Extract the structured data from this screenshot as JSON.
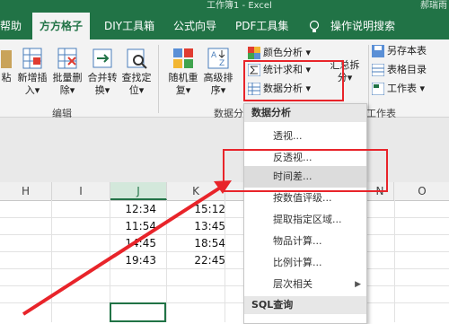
{
  "window": {
    "title": "工作簿1 - Excel",
    "account": "郝瑞雨"
  },
  "tabs": [
    "帮助",
    "方方格子",
    "DIY工具箱",
    "公式向导",
    "PDF工具集",
    "操作说明搜索"
  ],
  "ribbon": {
    "buttons": [
      {
        "label1": "粘",
        "label2": ""
      },
      {
        "label1": "新增插",
        "label2": "入▾"
      },
      {
        "label1": "批量删",
        "label2": "除▾"
      },
      {
        "label1": "合并转",
        "label2": "换▾"
      },
      {
        "label1": "查找定",
        "label2": "位▾"
      },
      {
        "label1": "随机重",
        "label2": "复▾"
      },
      {
        "label1": "高级排",
        "label2": "序▾"
      }
    ],
    "small_buttons": [
      "颜色分析 ▾",
      "统计求和 ▾",
      "数据分析 ▾"
    ],
    "right_buttons": [
      "另存本表",
      "表格目录",
      "工作表 ▾"
    ],
    "summary_split": {
      "label1": "汇总拆",
      "label2": "分▾"
    },
    "groups": [
      "编辑",
      "数据分",
      "工作表"
    ]
  },
  "sheet": {
    "columns": [
      "H",
      "I",
      "J",
      "K",
      "N",
      "O"
    ],
    "col_j": [
      "12:34",
      "11:54",
      "14:45",
      "19:43"
    ],
    "col_k": [
      "15:12",
      "13:45",
      "18:54",
      "22:45"
    ]
  },
  "menu": {
    "header": "数据分析",
    "items": [
      "透视...",
      "反透视...",
      "时间差...",
      "按数值评级...",
      "提取指定区域...",
      "物品计算...",
      "比例计算...",
      "层次相关"
    ],
    "section": "SQL查询"
  },
  "colors": {
    "excel_green": "#217346",
    "highlight_red": "#e8242a"
  }
}
